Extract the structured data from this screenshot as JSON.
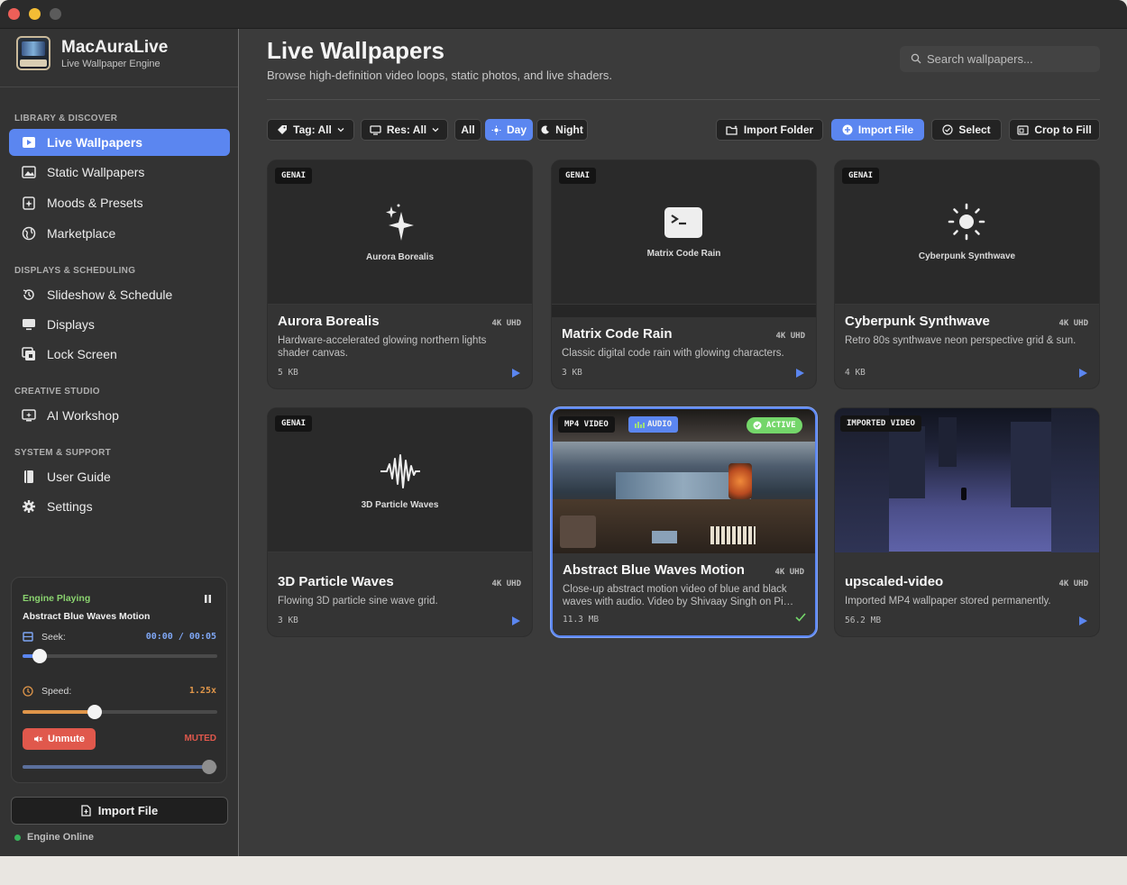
{
  "app": {
    "name": "MacAuraLive",
    "subtitle": "Live Wallpaper Engine"
  },
  "sidebar": {
    "sections": [
      "LIBRARY & DISCOVER",
      "DISPLAYS & SCHEDULING",
      "CREATIVE STUDIO",
      "SYSTEM & SUPPORT"
    ],
    "items": [
      {
        "label": "Live Wallpapers",
        "icon": "play-rect-icon",
        "active": true
      },
      {
        "label": "Static Wallpapers",
        "icon": "photo-icon"
      },
      {
        "label": "Moods & Presets",
        "icon": "sparkle-doc-icon"
      },
      {
        "label": "Marketplace",
        "icon": "globe-icon"
      },
      {
        "label": "Slideshow & Schedule",
        "icon": "clock-arrow-icon"
      },
      {
        "label": "Displays",
        "icon": "monitor-icon"
      },
      {
        "label": "Lock Screen",
        "icon": "lock-screen-icon"
      },
      {
        "label": "AI Workshop",
        "icon": "ai-monitor-icon"
      },
      {
        "label": "User Guide",
        "icon": "book-icon"
      },
      {
        "label": "Settings",
        "icon": "gear-icon"
      }
    ]
  },
  "player": {
    "status": "Engine Playing",
    "now_playing": "Abstract Blue Waves Motion",
    "seek_label": "Seek:",
    "seek_time": "00:00 / 00:05",
    "seek_progress": 0.09,
    "speed_label": "Speed:",
    "speed_value": "1.25x",
    "speed_progress": 0.37,
    "unmute_label": "Unmute",
    "muted_label": "MUTED",
    "volume_progress": 0.96
  },
  "sidebar_footer": {
    "import_label": "Import File",
    "status": "Engine Online"
  },
  "header": {
    "title": "Live Wallpapers",
    "subtitle": "Browse high-definition video loops, static photos, and live shaders.",
    "search_placeholder": "Search wallpapers..."
  },
  "toolbar": {
    "tag": "Tag: All",
    "res": "Res: All",
    "all": "All",
    "day": "Day",
    "night": "Night",
    "import_folder": "Import Folder",
    "import_file": "Import File",
    "select": "Select",
    "crop": "Crop to Fill"
  },
  "cards": [
    {
      "badge": "GENAI",
      "preview_label": "Aurora Borealis",
      "title": "Aurora Borealis",
      "res": "4K UHD",
      "desc": "Hardware-accelerated glowing northern lights shader canvas.",
      "size": "5 KB"
    },
    {
      "badge": "GENAI",
      "preview_label": "Matrix Code Rain",
      "title": "Matrix Code Rain",
      "res": "4K UHD",
      "desc": "Classic digital code rain with glowing characters.",
      "size": "3 KB"
    },
    {
      "badge": "GENAI",
      "preview_label": "Cyberpunk Synthwave",
      "title": "Cyberpunk Synthwave",
      "res": "4K UHD",
      "desc": "Retro 80s synthwave neon perspective grid & sun.",
      "size": "4 KB"
    },
    {
      "badge": "GENAI",
      "preview_label": "3D Particle Waves",
      "title": "3D Particle Waves",
      "res": "4K UHD",
      "desc": "Flowing 3D particle sine wave grid.",
      "size": "3 KB"
    },
    {
      "badge": "MP4 VIDEO",
      "badge2": "AUDIO",
      "active_badge": "ACTIVE",
      "title": "Abstract Blue Waves Motion",
      "res": "4K UHD",
      "desc": "Close-up abstract motion video of blue and black waves with audio. Video by Shivaay Singh on Pi…",
      "size": "11.3 MB"
    },
    {
      "badge": "IMPORTED VIDEO",
      "title": "upscaled-video",
      "res": "4K UHD",
      "desc": "Imported MP4 wallpaper stored permanently.",
      "size": "56.2 MB"
    }
  ],
  "colors": {
    "accent": "#5b86f0",
    "active_green": "#74d66a",
    "muted_red": "#e0584c",
    "speed_orange": "#e0964a"
  }
}
